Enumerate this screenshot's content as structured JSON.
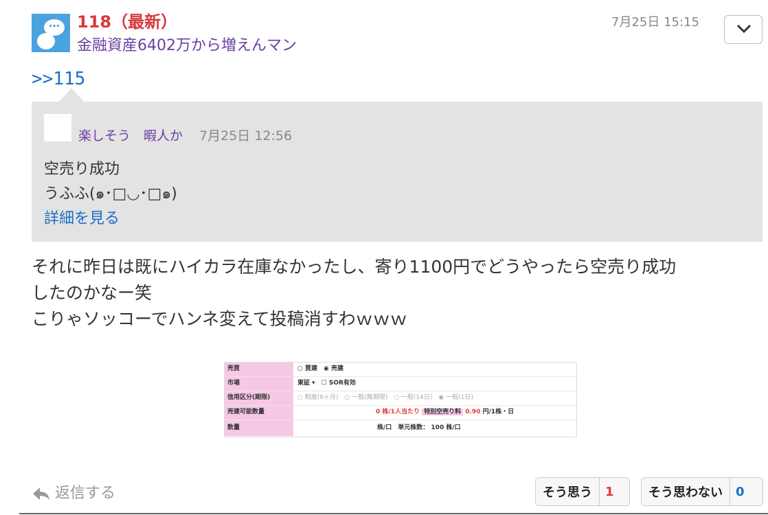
{
  "post": {
    "number_label": "118（最新）",
    "author": "金融資産6402万から増えんマン",
    "timestamp": "7月25日 15:15",
    "reply_ref": ">>115",
    "body_lines": [
      "それに昨日は既にハイカラ在庫なかったし、寄り1100円でどうやったら空売り成功",
      "したのかなー笑",
      "こりゃソッコーでハンネ変えて投稿消すわｗｗｗ"
    ]
  },
  "quote": {
    "author": "楽しそう　暇人か",
    "timestamp": "7月25日 12:56",
    "lines": [
      "空売り成功",
      "うふふ(๑･□◡･□๑)"
    ],
    "more_link": "詳細を見る"
  },
  "screenshot": {
    "rows": [
      {
        "label": "売買",
        "value": "○ 買建　◉ 売建"
      },
      {
        "label": "市場",
        "value": "東証 ▾　☐ SOR有効"
      },
      {
        "label": "信用区分(期限)",
        "value": "○ 制度(6ヶ月)　○ 一般(無期限)　○ 一般(14日)　◉ 一般(1日)"
      },
      {
        "label": "売建可能数量",
        "value_main": "0 株/1人当たり",
        "value_pink": "特別空売り料",
        "value_rate": "0.90",
        "value_unit": "円/1株・日"
      },
      {
        "label": "数量",
        "value": "株/口　単元株数： 100 株/口"
      }
    ]
  },
  "actions": {
    "reply_label": "返信する",
    "agree_label": "そう思う",
    "agree_count": "1",
    "disagree_label": "そう思わない",
    "disagree_count": "0"
  },
  "colors": {
    "post_number": "#d93a3a",
    "author": "#6a3fa0",
    "link": "#1a6fc7",
    "quote_bg": "#e3e3e3"
  }
}
